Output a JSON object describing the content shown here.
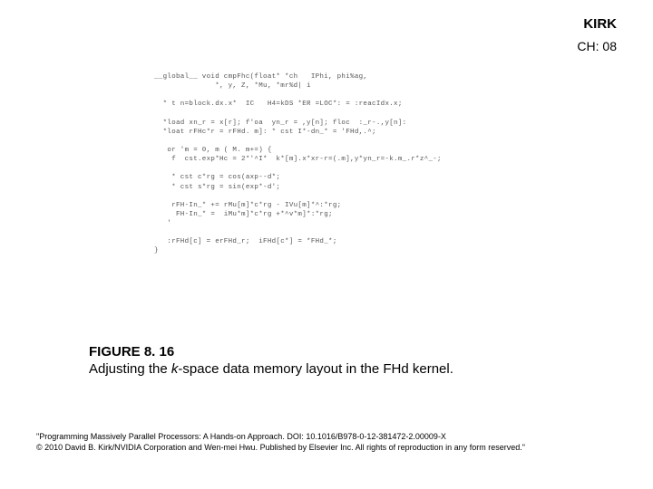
{
  "header": {
    "kirk": "KIRK",
    "chapter": "CH: 08"
  },
  "code": "__global__ void cmpFhc(float* *ch   IPhi, phi%ag,\n              *, y, Z, *Mu, *mr%d| i\n\n  * t n=block.dx.x*  IC   H4=kDS *ER =LOC*: = :reacIdx.x;\n\n  *load xn_r = x[r]; f'oa  yn_r = ,y[n]; floc  :_r-.,y[n]:\n  *loat rFHc*r = rFHd. m]: * cst I*-dn_* = 'FHd,.^;\n\n   or 'm = 0, m ( M. m+=) {\n    f  cst.exp*Hc = 2*'^I*  k*[m].x*xr-r=(.m],y*yn_r=-k.m_.r*z^_-;\n\n    * cst c*rg = cos(axp--d*;\n    * cst s*rg = sin(exp*-d';\n\n    rFH-In_* += rMu[m]*c*rg - IVu[m]*^:*rg;\n     FH-In_* =  iMu*m]*c*rg +*^v*m]*:*rg;\n   '\n\n   :rFHd[c] = erFHd_r;  iFHd[c*] = *FHd_*;\n}",
  "figure": {
    "number": "FIGURE 8. 16",
    "desc_pre": "Adjusting the ",
    "desc_italic": "k",
    "desc_post": "-space data memory layout in the FHd kernel."
  },
  "footer": {
    "line1": "\"Programming Massively Parallel Processors: A Hands-on Approach. DOI: 10.1016/B978-0-12-381472-2.00009-X",
    "line2": "© 2010 David B. Kirk/NVIDIA Corporation and Wen-mei Hwu. Published by Elsevier Inc. All rights of reproduction in any form reserved.\""
  }
}
